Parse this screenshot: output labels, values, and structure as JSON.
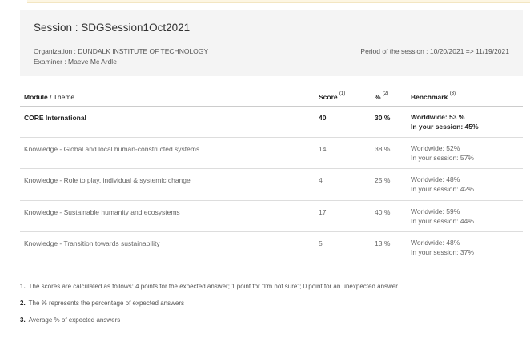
{
  "session": {
    "title": "Session : SDGSession1Oct2021",
    "organization": "Organization : DUNDALK INSTITUTE OF TECHNOLOGY",
    "examiner": "Examiner : Maeve Mc Ardle",
    "period": "Period of the session : 10/20/2021 => 11/19/2021"
  },
  "table": {
    "headers": {
      "module": "Module",
      "theme": " / Theme",
      "score": "Score",
      "score_sup": "(1)",
      "pct": "%",
      "pct_sup": "(2)",
      "bench": "Benchmark",
      "bench_sup": "(3)"
    },
    "rows": [
      {
        "module": "CORE International",
        "score": "40",
        "pct": "30 %",
        "worldwide": "Worldwide: 53 %",
        "session": "In your session: 45%"
      },
      {
        "module": "Knowledge - Global and local human-constructed systems",
        "score": "14",
        "pct": "38 %",
        "worldwide": "Worldwide: 52%",
        "session": "In your session: 57%"
      },
      {
        "module": "Knowledge - Role to play, individual & systemic change",
        "score": "4",
        "pct": "25 %",
        "worldwide": "Worldwide: 48%",
        "session": "In your session: 42%"
      },
      {
        "module": "Knowledge - Sustainable humanity and ecosystems",
        "score": "17",
        "pct": "40 %",
        "worldwide": "Worldwide: 59%",
        "session": "In your session: 44%"
      },
      {
        "module": "Knowledge - Transition towards sustainability",
        "score": "5",
        "pct": "13 %",
        "worldwide": "Worldwide: 48%",
        "session": "In your session: 37%"
      }
    ]
  },
  "notes": [
    {
      "num": "1.",
      "text": "The scores are calculated as follows: 4 points for the expected answer; 1 point for \"I'm not sure\"; 0 point for an unexpected answer."
    },
    {
      "num": "2.",
      "text": "The % represents the percentage of expected answers"
    },
    {
      "num": "3.",
      "text": "Average % of expected answers"
    }
  ]
}
